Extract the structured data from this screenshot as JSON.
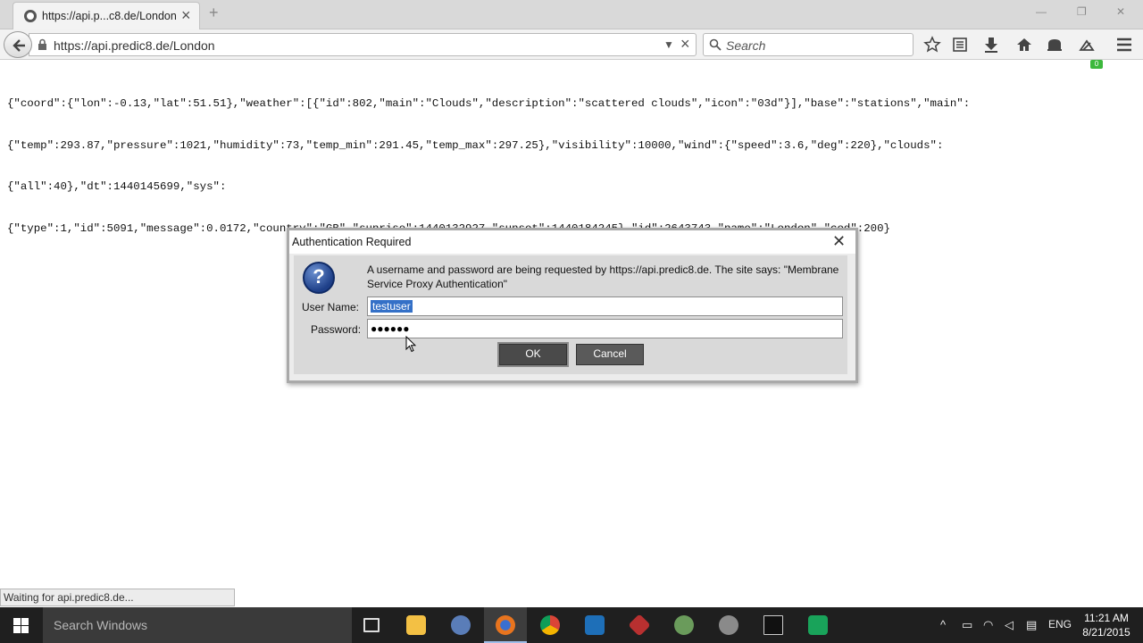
{
  "browser": {
    "tab": {
      "title": "https://api.p...c8.de/London"
    },
    "url": "https://api.predic8.de/London",
    "search_placeholder": "Search",
    "badge": "0"
  },
  "page": {
    "json_lines": [
      "{\"coord\":{\"lon\":-0.13,\"lat\":51.51},\"weather\":[{\"id\":802,\"main\":\"Clouds\",\"description\":\"scattered clouds\",\"icon\":\"03d\"}],\"base\":\"stations\",\"main\":",
      "{\"temp\":293.87,\"pressure\":1021,\"humidity\":73,\"temp_min\":291.45,\"temp_max\":297.25},\"visibility\":10000,\"wind\":{\"speed\":3.6,\"deg\":220},\"clouds\":",
      "{\"all\":40},\"dt\":1440145699,\"sys\":",
      "{\"type\":1,\"id\":5091,\"message\":0.0172,\"country\":\"GB\",\"sunrise\":1440132927,\"sunset\":1440184245},\"id\":2643743,\"name\":\"London\",\"cod\":200}"
    ]
  },
  "dialog": {
    "title": "Authentication Required",
    "message": "A username and password are being requested by https://api.predic8.de. The site says: \"Membrane Service Proxy Authentication\"",
    "username_label": "User Name:",
    "username_value": "testuser",
    "password_label": "Password:",
    "password_value": "●●●●●●",
    "ok_label": "OK",
    "cancel_label": "Cancel"
  },
  "status": {
    "text": "Waiting for api.predic8.de..."
  },
  "taskbar": {
    "search_text": "Search Windows",
    "tray_lang": "ENG",
    "time": "11:21 AM",
    "date": "8/21/2015"
  }
}
